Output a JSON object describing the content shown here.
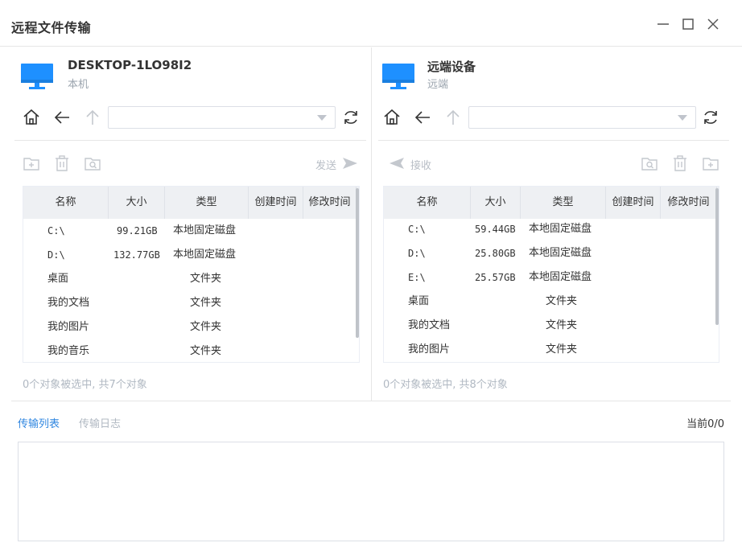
{
  "window": {
    "title": "远程文件传输"
  },
  "colors": {
    "accent": "#2f86e0",
    "monitor": "#1e90ff",
    "muted": "#b0b8c2"
  },
  "local": {
    "device_name": "DESKTOP-1LO98I2",
    "device_sub": "本机",
    "path_value": "",
    "action_label": "发送",
    "columns": [
      "名称",
      "大小",
      "类型",
      "创建时间",
      "修改时间"
    ],
    "rows": [
      {
        "name": "C:\\",
        "size": "99.21GB",
        "type": "本地固定磁盘"
      },
      {
        "name": "D:\\",
        "size": "132.77GB",
        "type": "本地固定磁盘"
      },
      {
        "name": "桌面",
        "size": "",
        "type": "文件夹"
      },
      {
        "name": "我的文档",
        "size": "",
        "type": "文件夹"
      },
      {
        "name": "我的图片",
        "size": "",
        "type": "文件夹"
      },
      {
        "name": "我的音乐",
        "size": "",
        "type": "文件夹"
      }
    ],
    "status": "0个对象被选中, 共7个对象"
  },
  "remote": {
    "device_name": "远端设备",
    "device_sub": "远端",
    "path_value": "",
    "action_label": "接收",
    "columns": [
      "名称",
      "大小",
      "类型",
      "创建时间",
      "修改时间"
    ],
    "rows": [
      {
        "name": "C:\\",
        "size": "59.44GB",
        "type": "本地固定磁盘"
      },
      {
        "name": "D:\\",
        "size": "25.80GB",
        "type": "本地固定磁盘"
      },
      {
        "name": "E:\\",
        "size": "25.57GB",
        "type": "本地固定磁盘"
      },
      {
        "name": "桌面",
        "size": "",
        "type": "文件夹"
      },
      {
        "name": "我的文档",
        "size": "",
        "type": "文件夹"
      },
      {
        "name": "我的图片",
        "size": "",
        "type": "文件夹"
      }
    ],
    "status": "0个对象被选中, 共8个对象"
  },
  "bottom": {
    "tabs": [
      "传输列表",
      "传输日志"
    ],
    "counter": "当前0/0"
  }
}
